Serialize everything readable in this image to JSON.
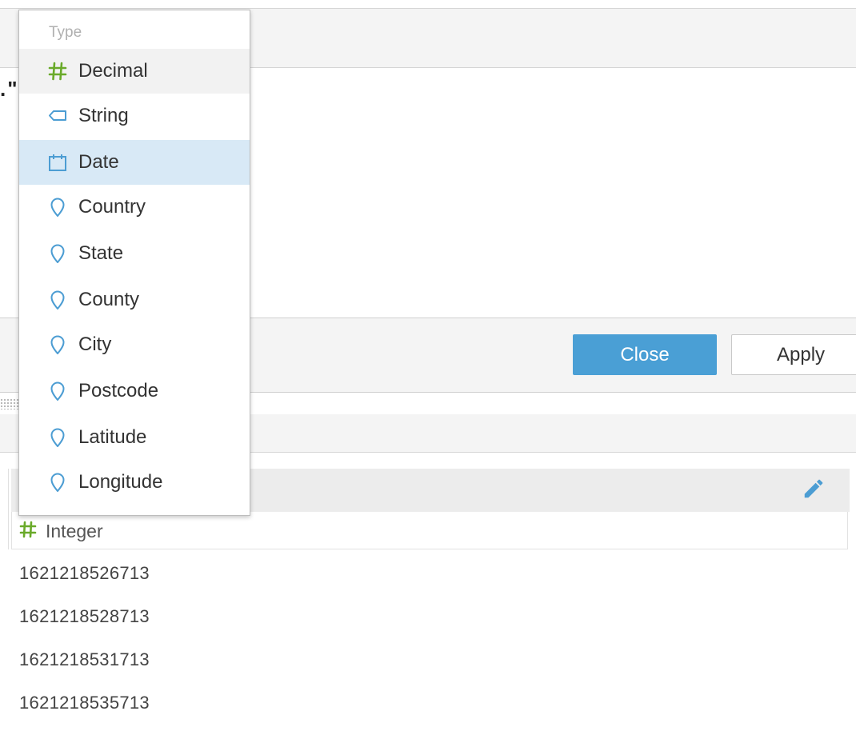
{
  "editor": {
    "stray_text": ".\""
  },
  "footer": {
    "close_label": "Close",
    "apply_label": "Apply"
  },
  "dropdown": {
    "header": "Type",
    "items": [
      {
        "label": "Decimal",
        "icon": "hash-icon",
        "state": "hover"
      },
      {
        "label": "String",
        "icon": "tag-icon",
        "state": "normal"
      },
      {
        "label": "Date",
        "icon": "calendar-icon",
        "state": "selected"
      },
      {
        "label": "Country",
        "icon": "map-pin-icon",
        "state": "normal"
      },
      {
        "label": "State",
        "icon": "map-pin-icon",
        "state": "normal"
      },
      {
        "label": "County",
        "icon": "map-pin-icon",
        "state": "normal"
      },
      {
        "label": "City",
        "icon": "map-pin-icon",
        "state": "normal"
      },
      {
        "label": "Postcode",
        "icon": "map-pin-icon",
        "state": "normal"
      },
      {
        "label": "Latitude",
        "icon": "map-pin-icon",
        "state": "normal"
      },
      {
        "label": "Longitude",
        "icon": "map-pin-icon",
        "state": "normal"
      }
    ]
  },
  "table": {
    "column_type": "Integer",
    "column_type_icon": "hash-icon",
    "rows": [
      "1621218526713",
      "1621218528713",
      "1621218531713",
      "1621218535713"
    ]
  },
  "colors": {
    "accent_blue": "#4a9fd5",
    "numeric_green": "#6aaa2a",
    "icon_blue": "#4c9dd3",
    "selected_bg": "#d8e9f6"
  }
}
